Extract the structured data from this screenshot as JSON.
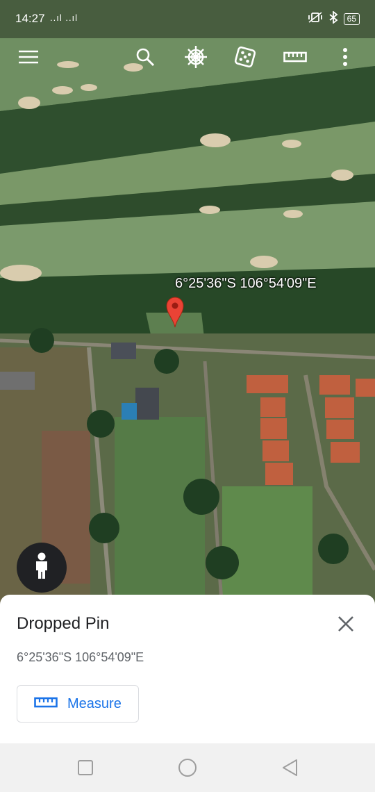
{
  "status_bar": {
    "time": "14:27",
    "signal": "..ıl ..ıl",
    "battery": "65"
  },
  "toolbar": {
    "icons": [
      "menu-icon",
      "search-icon",
      "voyager-wheel-icon",
      "dice-icon",
      "ruler-icon",
      "more-vert-icon"
    ]
  },
  "map": {
    "pin_label": "6°25'36\"S 106°54'09\"E",
    "pin_color": "#ea4335"
  },
  "sheet": {
    "title": "Dropped Pin",
    "coordinates": "6°25'36\"S 106°54'09\"E",
    "measure_label": "Measure",
    "accent_color": "#1a73e8"
  },
  "navbar": {
    "icons": [
      "recents-square-icon",
      "home-circle-icon",
      "back-triangle-icon"
    ]
  }
}
